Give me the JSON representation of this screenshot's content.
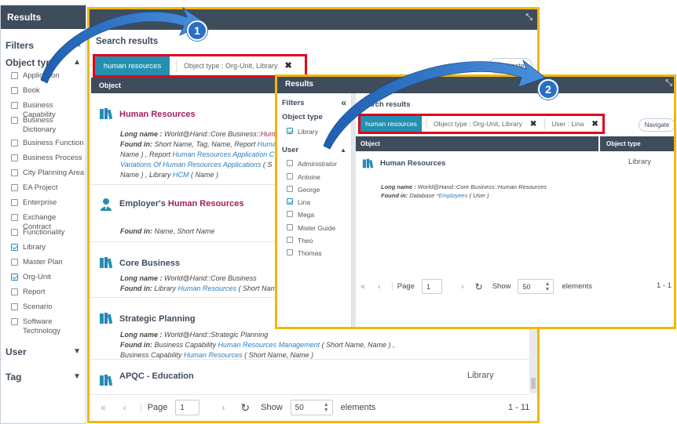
{
  "sidebar": {
    "header": "Results",
    "filters_label": "Filters",
    "object_type_label": "Object type",
    "items": [
      {
        "label": "Application",
        "checked": false
      },
      {
        "label": "Book",
        "checked": false
      },
      {
        "label": "Business Capability",
        "checked": false
      },
      {
        "label": "Business Dictionary",
        "checked": false,
        "wrap": true
      },
      {
        "label": "Business Function",
        "checked": false
      },
      {
        "label": "Business Process",
        "checked": false
      },
      {
        "label": "City Planning Area",
        "checked": false
      },
      {
        "label": "EA Project",
        "checked": false
      },
      {
        "label": "Enterprise",
        "checked": false
      },
      {
        "label": "Exchange Contract",
        "checked": false
      },
      {
        "label": "Functionality",
        "checked": false
      },
      {
        "label": "Library",
        "checked": true
      },
      {
        "label": "Master Plan",
        "checked": false
      },
      {
        "label": "Org-Unit",
        "checked": true
      },
      {
        "label": "Report",
        "checked": false
      },
      {
        "label": "Scenario",
        "checked": false
      },
      {
        "label": "Software Technology",
        "checked": false,
        "wrap": true
      }
    ],
    "user_label": "User",
    "tag_label": "Tag"
  },
  "main": {
    "search_results_label": "Search results",
    "chip": "human resources",
    "criterion": "Object type : Org-Unit, Library",
    "navigate": "Navigate",
    "col_object": "Object",
    "rows": [
      {
        "name": "Human Resources",
        "type": "",
        "lines": [
          {
            "pre": "Long name : ",
            "text": "World@Hand::Core Business::Huma"
          },
          {
            "pre": "Found in: ",
            "text": "Short Name, Tag, Name, Report ",
            "link": "Huma"
          },
          {
            "text": "Name ) , Report ",
            "link": "Human Resources Application C"
          },
          {
            "link": "Variations Of Human Resources Applications",
            "text": " ( S"
          },
          {
            "text": "Name ) , Library ",
            "link": "HCM",
            "post": " ( Name )"
          }
        ]
      },
      {
        "name_pre": "Employer's ",
        "name_hl": "Human Resources",
        "lines": [
          {
            "pre": "Found in: ",
            "text": "Name, Short Name"
          }
        ]
      },
      {
        "name": "Core Business",
        "lines": [
          {
            "pre": "Long name : ",
            "text": "World@Hand::Core Business"
          },
          {
            "pre": "Found in: ",
            "text": "Library ",
            "link": "Human Resources",
            "post": " ( Short Nam"
          }
        ]
      },
      {
        "name": "Strategic Planning",
        "lines": [
          {
            "pre": "Long name : ",
            "text": "World@Hand::Strategic Planning"
          },
          {
            "pre": "Found in: ",
            "text": "Business Capability ",
            "link": "Human Resources Management",
            "post": " ( Short Name, Name ) ,"
          },
          {
            "text": "Business Capability ",
            "link": "Human Resources",
            "post": " ( Short Name, Name )"
          }
        ]
      },
      {
        "name": "APQC - Education",
        "type": "Library",
        "lines": []
      }
    ],
    "pager": {
      "page_label": "Page",
      "page": "1",
      "show_label": "Show",
      "show": "50",
      "elements_label": "elements",
      "range": "1 - 11"
    }
  },
  "overlay": {
    "header": "Results",
    "filters_label": "Filters",
    "object_type_label": "Object type",
    "object_items": [
      {
        "label": "Library",
        "checked": true
      }
    ],
    "user_label": "User",
    "users": [
      {
        "label": "Administrator",
        "checked": false
      },
      {
        "label": "Antoine",
        "checked": false
      },
      {
        "label": "George",
        "checked": false
      },
      {
        "label": "Lina",
        "checked": true
      },
      {
        "label": "Mega",
        "checked": false
      },
      {
        "label": "Mister Guide",
        "checked": false
      },
      {
        "label": "Theo",
        "checked": false
      },
      {
        "label": "Thomas",
        "checked": false
      }
    ],
    "search_results_label": "Search results",
    "chip": "human resources",
    "criterion1": "Object type : Org-Unit, Library",
    "criterion2": "User : Lina",
    "navigate": "Navigate",
    "col_object": "Object",
    "col_type": "Object type",
    "row": {
      "name": "Human Resources",
      "type": "Library",
      "long_name_label": "Long name : ",
      "long_name": "World@Hand::Core Business::Human Resources",
      "found_in_label": "Found in: ",
      "found_in_text": "Database ",
      "found_in_link": "*Employees",
      "found_in_post": " ( User )"
    },
    "pager": {
      "page_label": "Page",
      "page": "1",
      "show_label": "Show",
      "show": "50",
      "elements_label": "elements",
      "range": "1 - 1"
    }
  },
  "callouts": {
    "first": "1",
    "second": "2"
  },
  "colors": {
    "header": "#3e4c5c",
    "chip": "#2390b0",
    "frame": "#f2b705",
    "highlight_box": "#e3001b",
    "callout": "#2a6fc4",
    "match": "#a3205c",
    "link": "#2a7fc1"
  }
}
